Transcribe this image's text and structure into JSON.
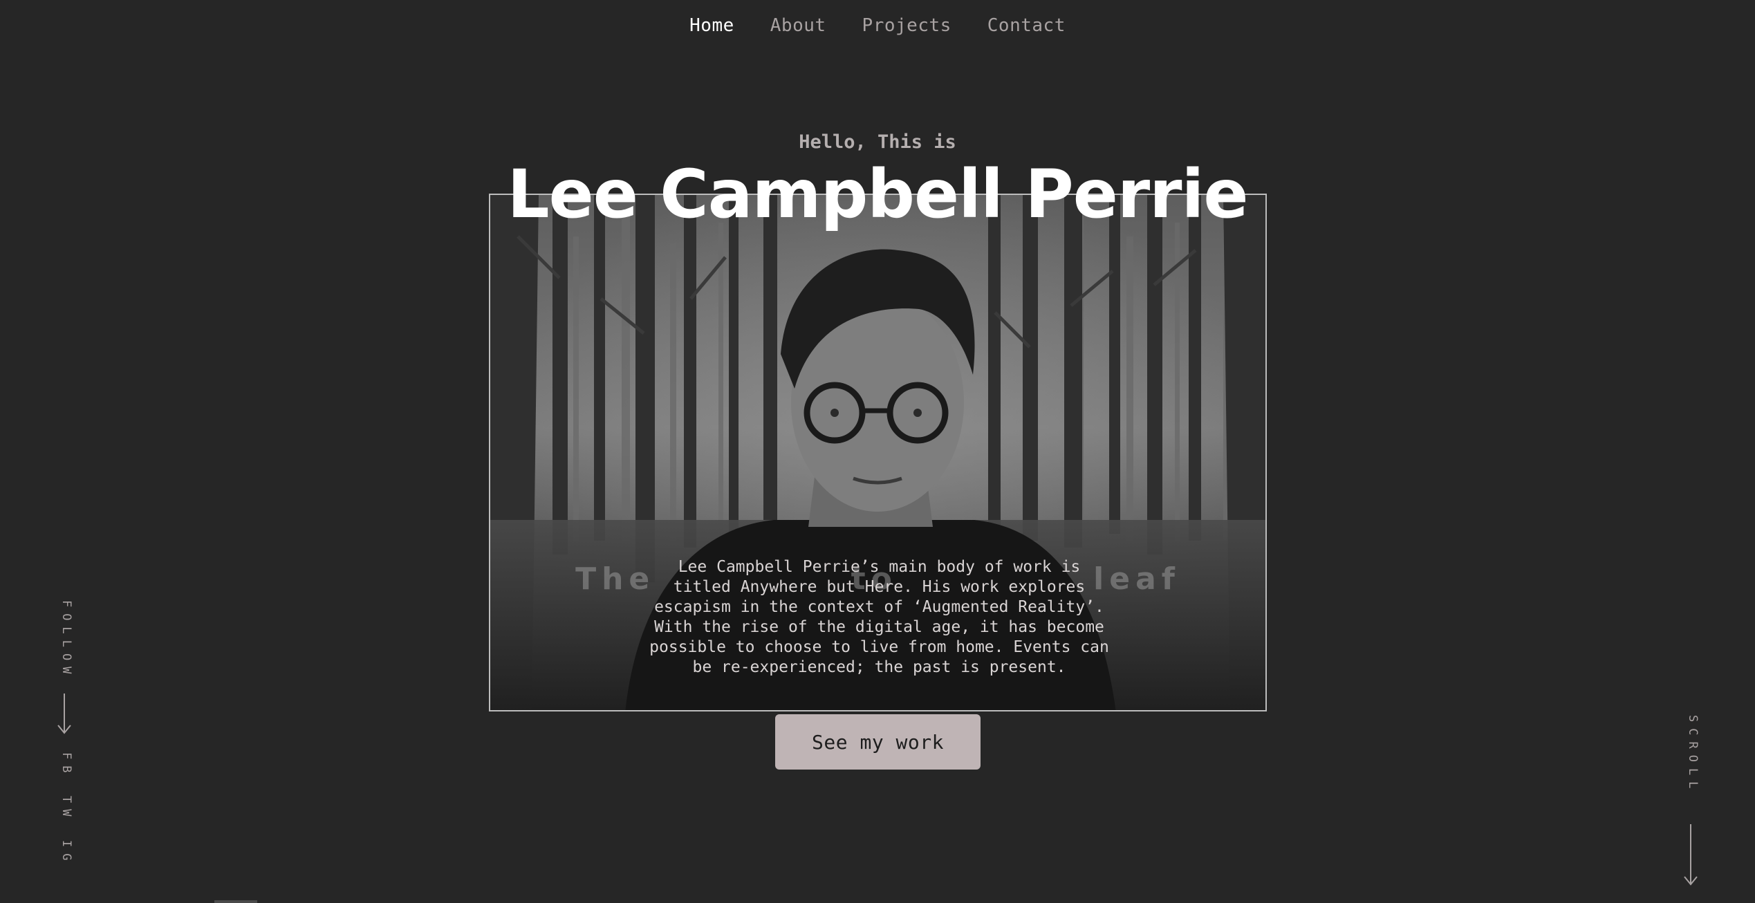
{
  "nav": {
    "items": [
      {
        "label": "Home",
        "active": true
      },
      {
        "label": "About",
        "active": false
      },
      {
        "label": "Projects",
        "active": false
      },
      {
        "label": "Contact",
        "active": false
      }
    ]
  },
  "hero": {
    "greeting": "Hello, This is",
    "name": "Lee Campbell Perrie",
    "background_caption": "The         to leaf",
    "description": "Lee Campbell Perrie’s main body of work is titled Anywhere but Here. His work explores escapism in the context of ‘Augmented Reality’. With the rise of the digital age, it has become possible to choose to live from home. Events can be re-experienced; the past is present.",
    "cta_label": "See my work"
  },
  "sidebar_left": {
    "follow_label": "FOLLOW",
    "arrow_icon": "arrow-down-icon",
    "social": [
      "FB",
      "TW",
      "IG"
    ]
  },
  "sidebar_right": {
    "scroll_label": "SCROLL",
    "arrow_icon": "arrow-down-icon"
  },
  "colors": {
    "background": "#262626",
    "nav_inactive": "#a8a2a2",
    "nav_active": "#ffffff",
    "button": "#bfb4b5"
  }
}
